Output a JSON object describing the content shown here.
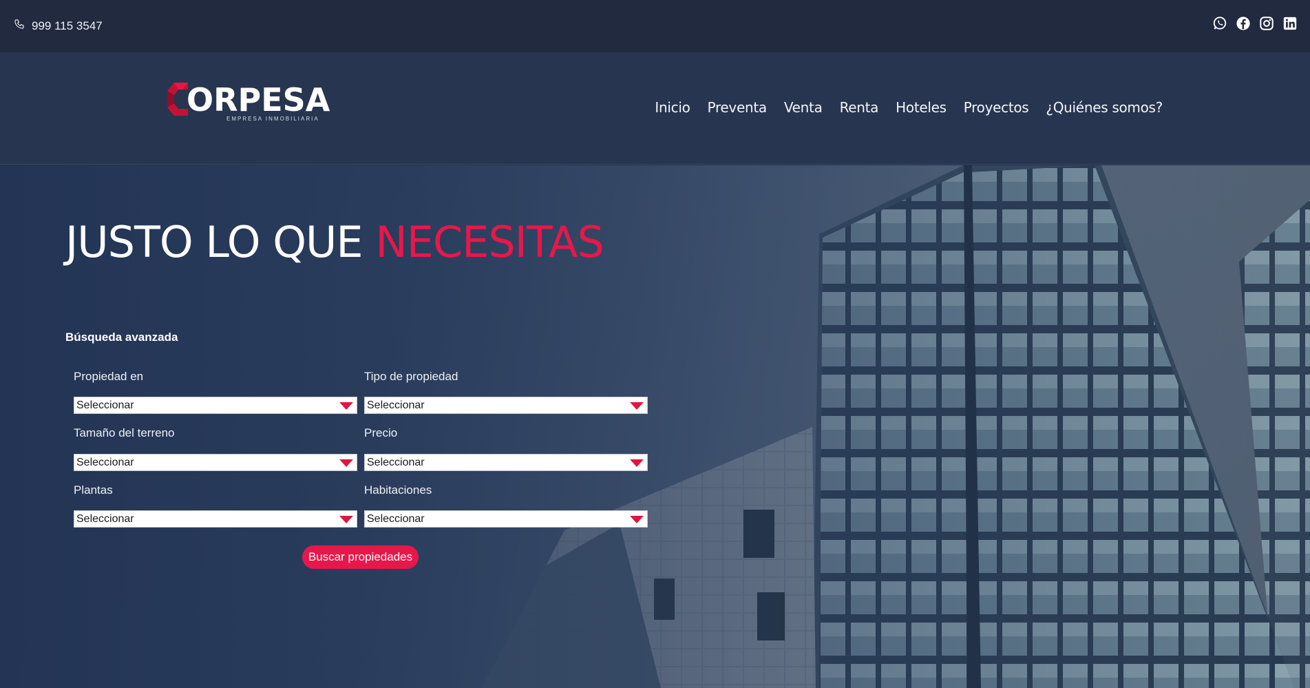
{
  "topbar": {
    "phone": "999 115 3547",
    "phone_icon": "phone-icon",
    "socials": [
      "whatsapp-icon",
      "facebook-icon",
      "instagram-icon",
      "linkedin-icon"
    ]
  },
  "brand": {
    "name": "ORPESA",
    "tagline": "EMPRESA INMOBILIARIA",
    "accent_color": "#e8174a"
  },
  "nav": {
    "items": [
      "Inicio",
      "Preventa",
      "Venta",
      "Renta",
      "Hoteles",
      "Proyectos",
      "¿Quiénes somos?"
    ]
  },
  "hero": {
    "headline_main": "JUSTO LO QUE ",
    "headline_accent": "NECESITAS"
  },
  "search": {
    "title": "Búsqueda avanzada",
    "fields": [
      {
        "label": "Propiedad en",
        "value": "Seleccionar"
      },
      {
        "label": "Tipo de propiedad",
        "value": "Seleccionar"
      },
      {
        "label": "Tamaño del terreno",
        "value": "Seleccionar"
      },
      {
        "label": "Precio",
        "value": "Seleccionar"
      },
      {
        "label": "Plantas",
        "value": "Seleccionar"
      },
      {
        "label": "Habitaciones",
        "value": "Seleccionar"
      }
    ],
    "button_label": "Buscar propiedades"
  }
}
